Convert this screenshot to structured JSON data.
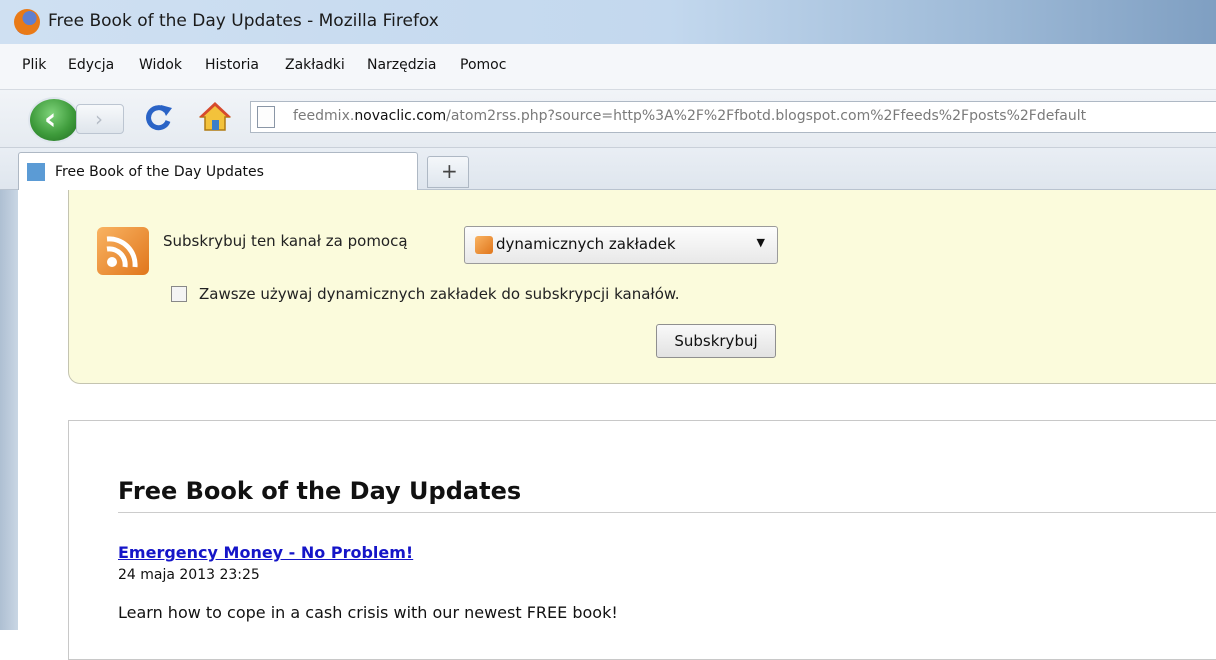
{
  "window": {
    "title": "Free Book of the Day Updates - Mozilla Firefox"
  },
  "menu": {
    "items": [
      "Plik",
      "Edycja",
      "Widok",
      "Historia",
      "Zakładki",
      "Narzędzia",
      "Pomoc"
    ]
  },
  "navigation": {
    "url_prefix": "feedmix.",
    "url_domain": "novaclic.com",
    "url_path": "/atom2rss.php?source=http%3A%2F%2Ffbotd.blogspot.com%2Ffeeds%2Fposts%2Fdefault"
  },
  "tabs": {
    "active_title": "Free Book of the Day Updates",
    "new_tab": "+"
  },
  "feed_header": {
    "subscribe_label": "Subskrybuj ten kanał za pomocą",
    "reader_selected": "dynamicznych zakładek",
    "always_use_label": "Zawsze używaj dynamicznych zakładek do subskrypcji kanałów.",
    "always_use_checked": false,
    "subscribe_button": "Subskrybuj"
  },
  "feed": {
    "title": "Free Book of the Day Updates",
    "entries": [
      {
        "title": "Emergency Money - No Problem!",
        "date": "24 maja 2013 23:25",
        "summary": "Learn how to cope in a cash crisis with our newest FREE book!"
      }
    ]
  }
}
